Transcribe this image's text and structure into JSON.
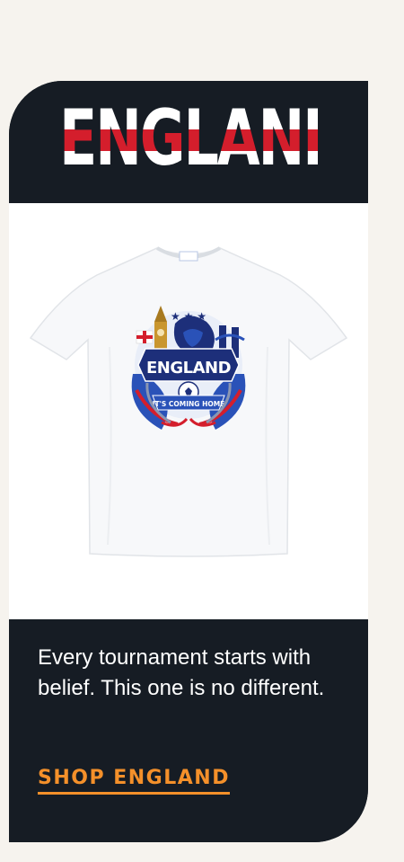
{
  "header": {
    "title": "ENGLAND"
  },
  "product": {
    "graphic_title": "ENGLAND",
    "graphic_banner": "IT'S COMING HOME",
    "colors": {
      "red": "#d41e2c",
      "navy": "#1d2f7a",
      "blue": "#2a52b8",
      "gold": "#c9962e"
    }
  },
  "footer": {
    "tagline": "Every tournament starts with belief. This one is no different.",
    "cta_label": "SHOP ENGLAND",
    "cta_color": "#f4902a"
  },
  "theme": {
    "page_bg": "#f6f3ee",
    "card_bg": "#161c24",
    "accent_red": "#d41e2c"
  }
}
